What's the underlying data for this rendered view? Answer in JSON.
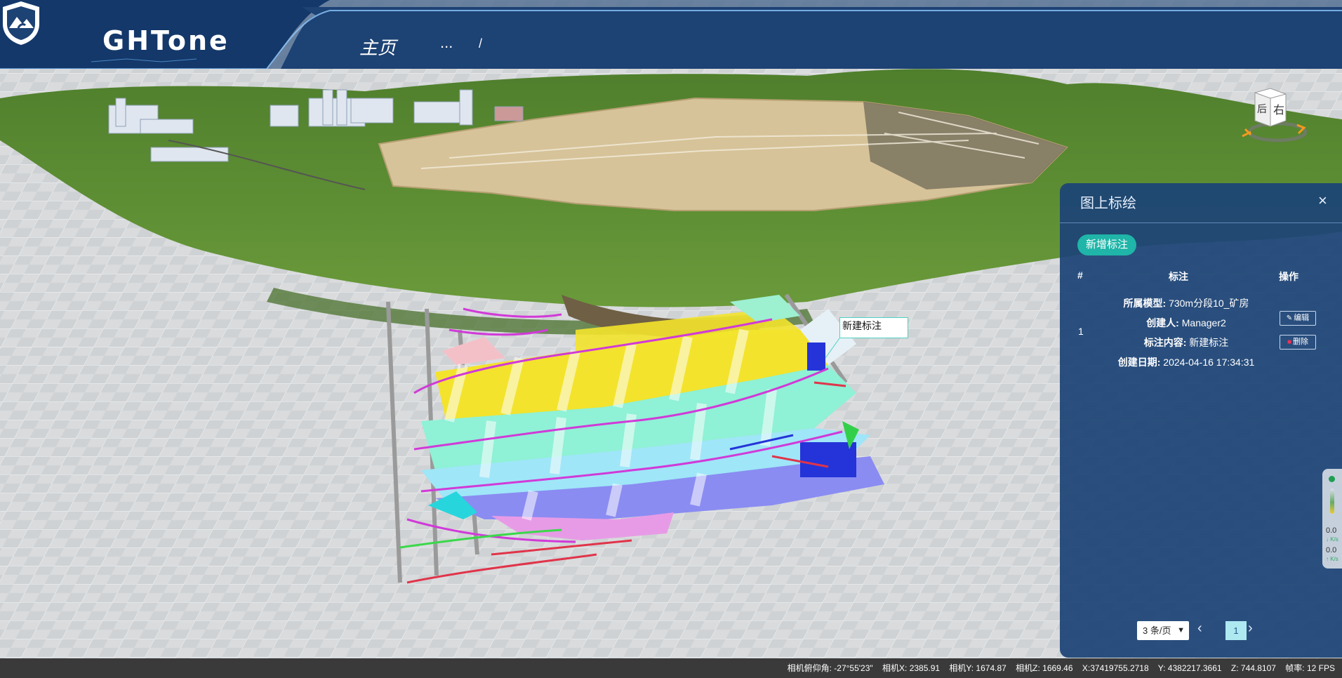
{
  "app": {
    "brand": "GHTone"
  },
  "nav": {
    "home": "主页",
    "more": "...",
    "separator": "/"
  },
  "navcube": {
    "face_front": "右",
    "face_side": "后"
  },
  "scene": {
    "label": "新建标注"
  },
  "panel": {
    "title": "图上标绘",
    "close": "×",
    "add_button": "新增标注",
    "columns": {
      "index": "#",
      "label": "标注",
      "ops": "操作"
    },
    "rows": [
      {
        "index": "1",
        "model_key": "所属模型:",
        "model": "730m分段10_矿房",
        "creator_key": "创建人:",
        "creator": "Manager2",
        "content_key": "标注内容:",
        "content": "新建标注",
        "date_key": "创建日期:",
        "date": "2024-04-16 17:34:31",
        "edit": "编辑",
        "delete": "删除"
      }
    ],
    "pager": {
      "page_size": "3 条/页",
      "page": "1",
      "prev": "‹",
      "next": "›"
    }
  },
  "speed": {
    "down_value": "0.0",
    "down_unit": "↓ K/s",
    "up_value": "0.0",
    "up_unit": "↑ K/s"
  },
  "status": {
    "pitch": "相机俯仰角: -27°55'23\"",
    "cam_x": "相机X: 2385.91",
    "cam_y": "相机Y: 1674.87",
    "cam_z": "相机Z: 1669.46",
    "x": "X:37419755.2718",
    "y": "Y: 4382217.3661",
    "z": "Z: 744.8107",
    "fps": "帧率: 12 FPS"
  },
  "colors": {
    "header": "#1a3d6b",
    "panel": "#1c4476",
    "accent": "#1fb5a8",
    "terrain": "#5a8a33",
    "pit": "#d8c49a",
    "status_bar": "#3a3a3a"
  }
}
